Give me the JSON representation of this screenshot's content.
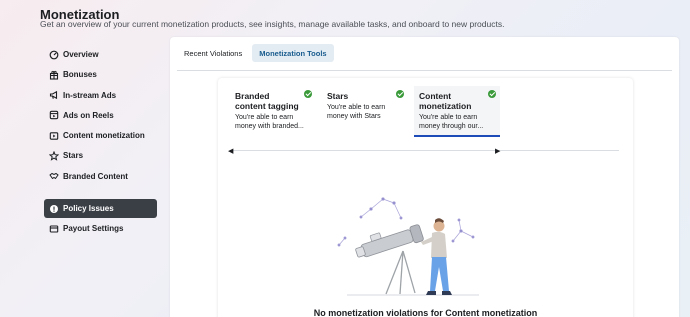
{
  "header": {
    "title": "Monetization",
    "subtitle": "Get an overview of your current monetization products, see insights, manage available tasks, and onboard to new products."
  },
  "sidebar": {
    "items": [
      {
        "label": "Overview",
        "icon": "overview-icon"
      },
      {
        "label": "Bonuses",
        "icon": "gift-icon"
      },
      {
        "label": "In-stream Ads",
        "icon": "megaphone-icon"
      },
      {
        "label": "Ads on Reels",
        "icon": "reels-icon"
      },
      {
        "label": "Content monetization",
        "icon": "content-monetization-icon"
      },
      {
        "label": "Stars",
        "icon": "stars-icon"
      },
      {
        "label": "Branded Content",
        "icon": "handshake-icon"
      }
    ],
    "bottom_items": [
      {
        "label": "Policy Issues",
        "icon": "alert-icon",
        "active": true
      },
      {
        "label": "Payout Settings",
        "icon": "bank-icon"
      }
    ]
  },
  "tabs": [
    {
      "label": "Recent Violations",
      "active": false
    },
    {
      "label": "Monetization Tools",
      "active": true
    }
  ],
  "products": [
    {
      "title": "Branded content tagging",
      "desc": "You're able to earn money with branded...",
      "status": "check-icon"
    },
    {
      "title": "Stars",
      "desc": "You're able to earn money with Stars",
      "status": "check-icon"
    },
    {
      "title": "Content monetization",
      "desc": "You're able to earn money through our...",
      "status": "check-icon",
      "active": true
    }
  ],
  "nav": {
    "prev": "◀",
    "next": "▶"
  },
  "empty_state": {
    "message": "No monetization violations for Content monetization",
    "illustration": "telescope-illustration"
  },
  "colors": {
    "accent": "#1d4bb8",
    "active_tab_bg": "#e4ecf3",
    "active_side_bg": "#3a3f46",
    "check": "#3a9a3a"
  }
}
